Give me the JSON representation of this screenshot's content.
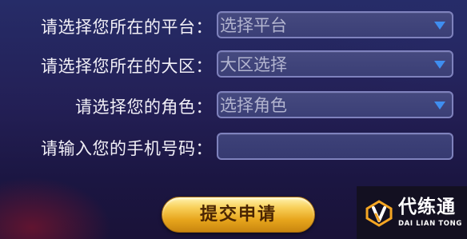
{
  "form": {
    "platform": {
      "label": "请选择您所在的平台：",
      "value": "选择平台"
    },
    "region": {
      "label": "请选择您所在的大区：",
      "value": "大区选择"
    },
    "role": {
      "label": "请选择您的角色：",
      "value": "选择角色"
    },
    "phone": {
      "label": "请输入您的手机号码：",
      "value": ""
    },
    "submit_label": "提交申请"
  },
  "watermark": {
    "name": "代练通",
    "subtitle": "DAI LIAN TONG"
  },
  "colors": {
    "accent": "#3f8ef0",
    "field_border": "#7f82bd",
    "button_gold": "#f0b73a",
    "logo_orange": "#f5a623"
  },
  "icons": [
    "dropdown-arrow-icon",
    "dailiantong-logo-icon"
  ]
}
